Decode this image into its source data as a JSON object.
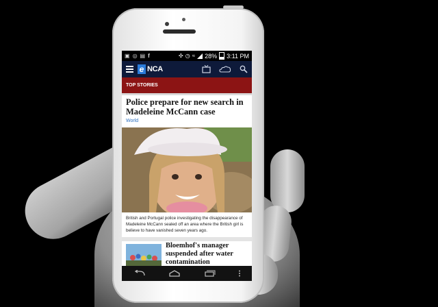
{
  "status_bar": {
    "battery": "28%",
    "time": "3:11 PM",
    "left_icons": [
      "image-icon",
      "whatsapp-icon",
      "chat-icon",
      "facebook-icon"
    ],
    "right_icons": [
      "run-icon",
      "alarm-icon",
      "wifi-icon",
      "signal-icon",
      "battery-icon"
    ]
  },
  "app_bar": {
    "logo_e": "e",
    "logo_rest": "NCA",
    "icons": [
      "menu-icon",
      "tv-icon",
      "weather-icon",
      "search-icon"
    ]
  },
  "section": {
    "label": "TOP STORIES"
  },
  "main_story": {
    "headline": "Police prepare for new search in Madeleine McCann case",
    "category": "World",
    "caption": "British and Portugal police investigating the disappearance of Madeleine McCann sealed off an area where the British girl is believe to have vanished seven years ago."
  },
  "second_story": {
    "headline": "Bloemhof's manager suspended after water contamination"
  },
  "nav_bar": {
    "icons": [
      "back-icon",
      "home-icon",
      "recents-icon",
      "overflow-icon"
    ]
  },
  "colors": {
    "brand_navy": "#0e1a3a",
    "section_red": "#8c1414",
    "logo_blue": "#2b7bd9",
    "link_blue": "#2b6fc0"
  }
}
